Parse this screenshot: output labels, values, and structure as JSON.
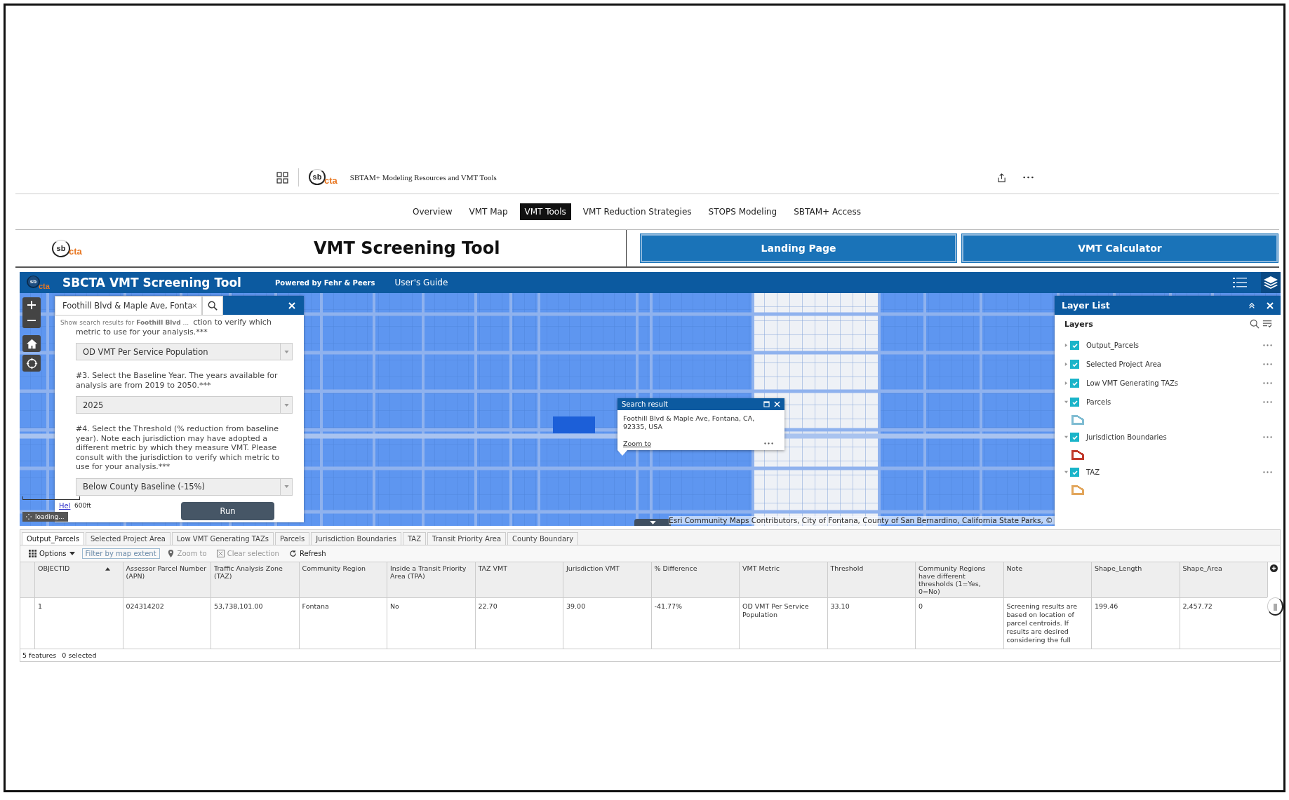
{
  "header": {
    "logo": {
      "mark": "sb",
      "name": "cta"
    },
    "title": "SBTAM+ Modeling Resources and VMT Tools"
  },
  "nav": [
    {
      "label": "Overview",
      "selected": false
    },
    {
      "label": "VMT Map",
      "selected": false
    },
    {
      "label": "VMT Tools",
      "selected": true
    },
    {
      "label": "VMT Reduction Strategies",
      "selected": false
    },
    {
      "label": "STOPS Modeling",
      "selected": false
    },
    {
      "label": "SBTAM+ Access",
      "selected": false
    }
  ],
  "banner": {
    "logo": {
      "mark": "sb",
      "name": "cta"
    },
    "title": "VMT Screening Tool",
    "buttons": [
      "Landing Page",
      "VMT Calculator"
    ]
  },
  "app": {
    "logo": {
      "mark": "sb",
      "name": "cta"
    },
    "title": "SBCTA VMT Screening Tool",
    "links": [
      "Powered by Fehr & Peers",
      "User's Guide"
    ]
  },
  "search": {
    "value": "Foothill Blvd & Maple Ave, Fonta",
    "hint": "Show search results for **Foothill Blvd** ..."
  },
  "panel": {
    "fragment": "ction to verify which",
    "items": [
      {
        "kind": "text",
        "text": "metric to use for your analysis.***"
      },
      {
        "kind": "select",
        "value": "OD VMT Per Service Population"
      },
      {
        "kind": "text",
        "text": "#3. Select the Baseline Year. The years available for analysis are from 2019 to 2050.***"
      },
      {
        "kind": "select",
        "value": "2025"
      },
      {
        "kind": "text",
        "text": "#4. Select the Threshold (% reduction from baseline year). Note each jurisdiction may have adopted a different metric by which they measure VMT. Please consult with the jurisdiction to verify which metric to use for your analysis.***"
      },
      {
        "kind": "select",
        "value": "Below County Baseline (-15%)"
      }
    ],
    "run": "Run"
  },
  "map": {
    "help": "Hel",
    "scale": "600ft",
    "status": "loading...",
    "attribution": "Esri Community Maps Contributors, City of Fontana, County of San Bernardino, California State Parks, ©"
  },
  "popup": {
    "title": "Search result",
    "address": "Foothill Blvd & Maple Ave, Fontana, CA, 92335, USA",
    "link": "Zoom to"
  },
  "layer_list": {
    "title": "Layer List",
    "heading": "Layers",
    "layers": [
      {
        "name": "Output_Parcels",
        "checked": true,
        "expanded": false
      },
      {
        "name": "Selected Project Area",
        "checked": true,
        "expanded": false
      },
      {
        "name": "Low VMT Generating TAZs",
        "checked": true,
        "expanded": false
      },
      {
        "name": "Parcels",
        "checked": true,
        "expanded": true,
        "color": "#7fbcd2"
      },
      {
        "name": "Jurisdiction Boundaries",
        "checked": true,
        "expanded": true,
        "color": "#c0392b"
      },
      {
        "name": "TAZ",
        "checked": true,
        "expanded": true,
        "color": "#e2a65c"
      }
    ]
  },
  "table": {
    "tabs": [
      {
        "label": "Output_Parcels",
        "selected": true
      },
      {
        "label": "Selected Project Area",
        "selected": false
      },
      {
        "label": "Low VMT Generating TAZs",
        "selected": false
      },
      {
        "label": "Parcels",
        "selected": false
      },
      {
        "label": "Jurisdiction Boundaries",
        "selected": false
      },
      {
        "label": "TAZ",
        "selected": false
      },
      {
        "label": "Transit Priority Area",
        "selected": false
      },
      {
        "label": "County Boundary",
        "selected": false
      }
    ],
    "toolbar": [
      {
        "kind": "options",
        "label": "Options",
        "disabled": false
      },
      {
        "kind": "filter",
        "label": "Filter by map extent",
        "disabled": false
      },
      {
        "kind": "zoom",
        "label": "Zoom to",
        "disabled": true
      },
      {
        "kind": "clear",
        "label": "Clear selection",
        "disabled": true
      },
      {
        "kind": "refresh",
        "label": "Refresh",
        "disabled": false
      }
    ],
    "columns": [
      {
        "label": "OBJECTID",
        "sorted": true
      },
      {
        "label": "Assessor Parcel Number (APN)",
        "sorted": false
      },
      {
        "label": "Traffic Analysis Zone (TAZ)",
        "sorted": false
      },
      {
        "label": "Community Region",
        "sorted": false
      },
      {
        "label": "Inside a Transit Priority Area (TPA)",
        "sorted": false
      },
      {
        "label": "TAZ VMT",
        "sorted": false
      },
      {
        "label": "Jurisdiction VMT",
        "sorted": false
      },
      {
        "label": "% Difference",
        "sorted": false
      },
      {
        "label": "VMT Metric",
        "sorted": false
      },
      {
        "label": "Threshold",
        "sorted": false
      },
      {
        "label": "Community Regions have different thresholds (1=Yes, 0=No)",
        "sorted": false
      },
      {
        "label": "Note",
        "sorted": false
      },
      {
        "label": "Shape_Length",
        "sorted": false
      },
      {
        "label": "Shape_Area",
        "sorted": false
      }
    ],
    "rows": [
      [
        "1",
        "024314202",
        "53,738,101.00",
        "Fontana",
        "No",
        "22.70",
        "39.00",
        "-41.77%",
        "OD VMT Per Service Population",
        "33.10",
        "0",
        "Screening results are based on location of parcel centroids. If results are desired considering the full",
        "199.46",
        "2,457.72"
      ]
    ],
    "footer": [
      "5 features",
      "0 selected"
    ]
  }
}
